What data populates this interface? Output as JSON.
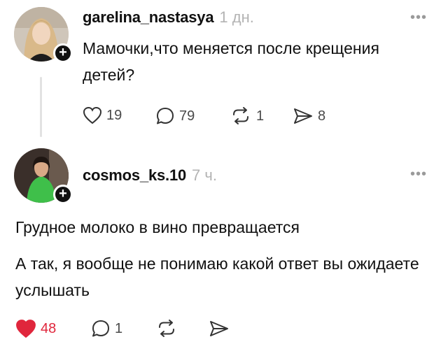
{
  "post1": {
    "username": "garelina_nastasya",
    "time": "1 дн.",
    "text": "Мамочки,что меняется после крещения детей?",
    "likes": "19",
    "replies": "79",
    "reposts": "1",
    "shares": "8"
  },
  "post2": {
    "username": "cosmos_ks.10",
    "time": "7 ч.",
    "paragraph1": "Грудное молоко в вино превращается",
    "paragraph2": "А так, я вообще не понимаю какой ответ вы ожидаете услышать",
    "likes": "48",
    "replies": "1"
  },
  "icons": {
    "follow": "+",
    "more": "•••"
  },
  "colors": {
    "like_active": "#e0263c",
    "muted": "#9a9a9a"
  }
}
